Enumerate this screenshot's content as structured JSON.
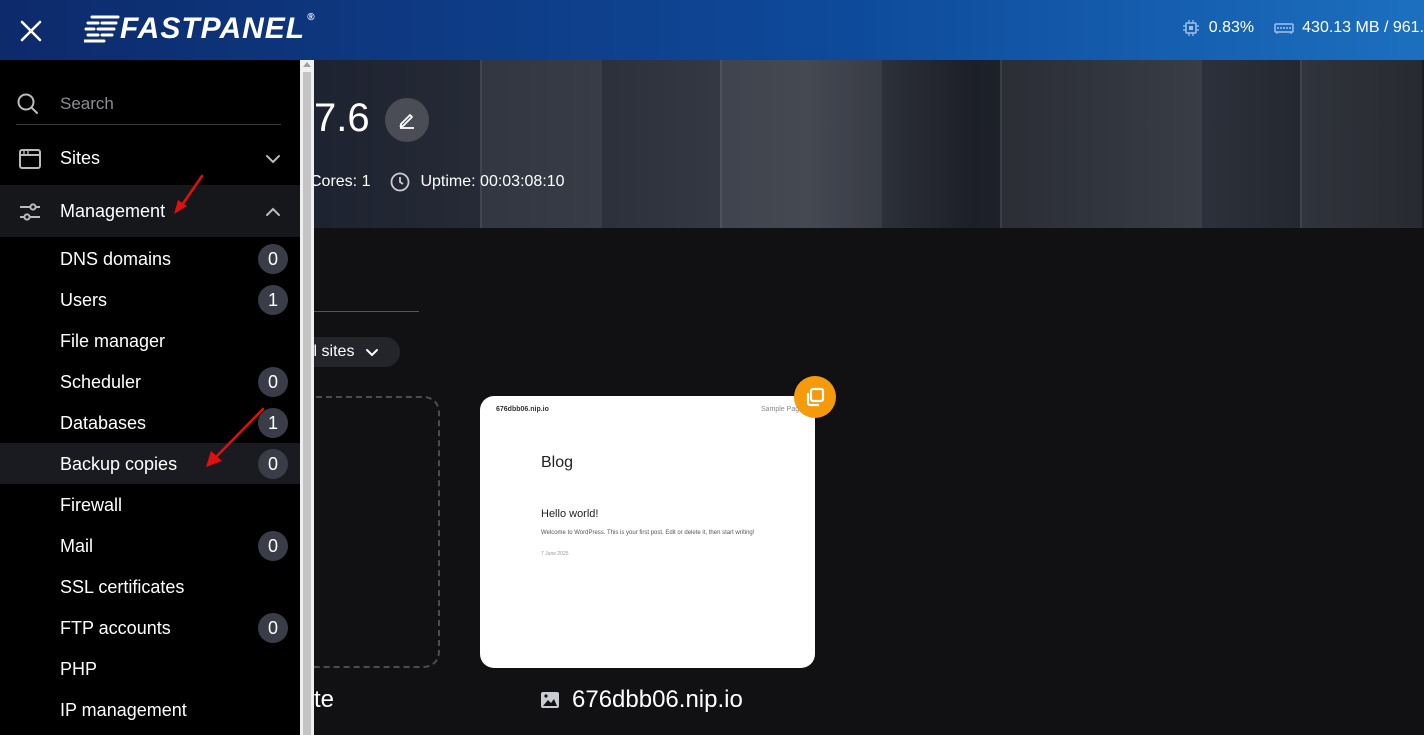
{
  "topbar": {
    "logo_text": "FASTPANEL",
    "logo_mark": "®",
    "cpu_value": "0.83%",
    "memory_value": "430.13 MB / 961."
  },
  "hero": {
    "title_fragment": "7.6",
    "cores_text": "Cores: 1",
    "uptime_text": "Uptime: 00:03:08:10"
  },
  "filter": {
    "label": "ll sites"
  },
  "add_site": {
    "label_fragment": "te"
  },
  "site_card": {
    "host": "676dbb06.nip.io",
    "sample_link": "Sample Page",
    "blog_title": "Blog",
    "post_title": "Hello world!",
    "post_excerpt": "Welcome to WordPress. This is your first post. Edit or delete it, then start writing!",
    "post_date": "7 June 2025",
    "name": "676dbb06.nip.io"
  },
  "sidebar": {
    "search_placeholder": "Search",
    "groups": [
      {
        "label": "Sites",
        "icon": "browser-window-icon",
        "expanded": false
      },
      {
        "label": "Management",
        "icon": "sliders-icon",
        "expanded": true
      }
    ],
    "items": [
      {
        "label": "DNS domains",
        "badge": "0"
      },
      {
        "label": "Users",
        "badge": "1"
      },
      {
        "label": "File manager",
        "badge": null
      },
      {
        "label": "Scheduler",
        "badge": "0"
      },
      {
        "label": "Databases",
        "badge": "1"
      },
      {
        "label": "Backup copies",
        "badge": "0"
      },
      {
        "label": "Firewall",
        "badge": null
      },
      {
        "label": "Mail",
        "badge": "0"
      },
      {
        "label": "SSL certificates",
        "badge": null
      },
      {
        "label": "FTP accounts",
        "badge": "0"
      },
      {
        "label": "PHP",
        "badge": null
      },
      {
        "label": "IP management",
        "badge": null
      }
    ],
    "active_item": "Backup copies"
  },
  "colors": {
    "topbar_start": "#0d2a6b",
    "topbar_end": "#1c6fbf",
    "accent_orange": "#f59a0b",
    "badge_bg": "#3a3d48",
    "annotation_red": "#e01010"
  }
}
